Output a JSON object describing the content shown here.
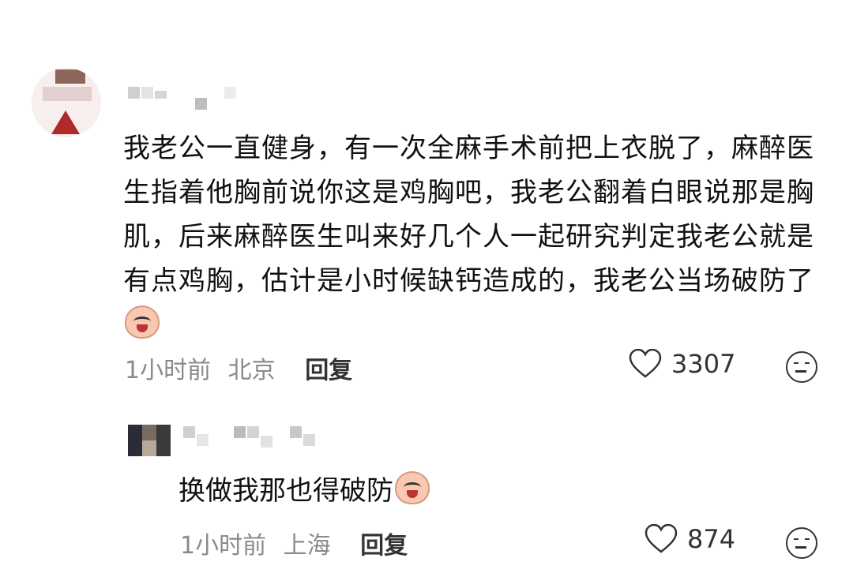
{
  "comment": {
    "username": "",
    "text": "我老公一直健身，有一次全麻手术前把上衣脱了，麻醉医生指着他胸前说你这是鸡胸吧，我老公翻着白眼说那是胸肌，后来麻醉医生叫来好几个人一起研究判定我老公就是有点鸡胸，估计是小时候缺钙造成的，我老公当场破防了",
    "emoji_icon": "crying-laughing-emoji-icon",
    "time": "1小时前",
    "location": "北京",
    "reply_label": "回复",
    "likes": "3307"
  },
  "reply": {
    "username": "",
    "text": "换做我那也得破防",
    "emoji_icon": "crying-laughing-emoji-icon",
    "time": "1小时前",
    "location": "上海",
    "reply_label": "回复",
    "likes": "874"
  },
  "colors": {
    "text": "#111111",
    "meta": "#8a8a8a",
    "icon": "#333333"
  }
}
